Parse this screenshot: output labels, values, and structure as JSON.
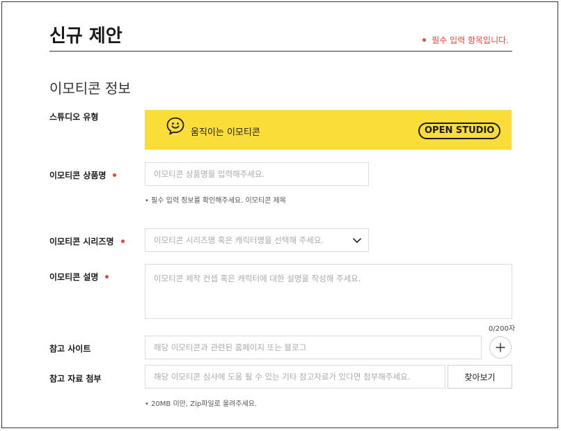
{
  "page": {
    "title": "신규 제안",
    "required_note": "필수 입력 항목입니다.",
    "section_title": "이모티콘 정보"
  },
  "colors": {
    "accent": "#fbdd3a",
    "required": "#e8453c"
  },
  "studio_type": {
    "label": "스튜디오 유형",
    "option": "움직이는 이모티콘",
    "badge": "OPEN STUDIO",
    "icon": "smile-speech-icon"
  },
  "product_name": {
    "label": "이모티콘 상품명",
    "placeholder": "이모티콘 상품명을 입력해주세요.",
    "helper": "• 필수 입력 정보를 확인해주세요. 이모티콘 제목"
  },
  "series_name": {
    "label": "이모티콘 시리즈명",
    "placeholder": "이모티콘 시리즈명 혹은 캐릭터명을 선택해 주세요.",
    "icon": "chevron-down-icon"
  },
  "description": {
    "label": "이모티콘 설명",
    "placeholder": "이모티콘 제작 컨셉 혹은 캐릭터에 대한 설명을 작성해 주세요.",
    "counter": "0/200자"
  },
  "reference_site": {
    "label": "참고 사이트",
    "placeholder": "해당 이모티콘과 관련된 홈페이지 또는 블로그",
    "icon": "plus-icon"
  },
  "attachment": {
    "label": "참고 자료 첨부",
    "placeholder": "해당 이모티콘 심사에 도움 될 수 있는 기타 참고자료가 있다면 첨부해주세요.",
    "button": "찾아보기",
    "helper": "• 20MB 미만, Zip파일로 올려주세요."
  }
}
